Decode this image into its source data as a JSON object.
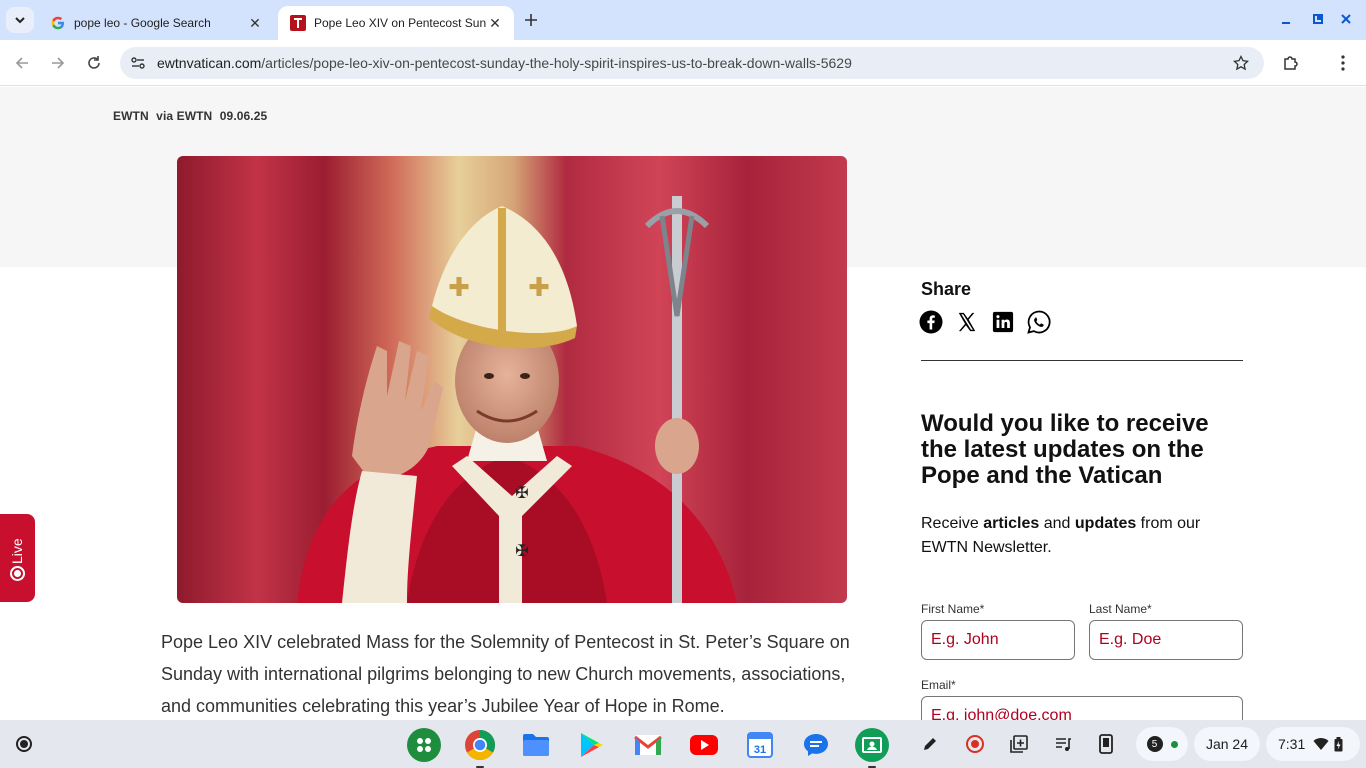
{
  "browser": {
    "tabs": [
      {
        "title": "pope leo - Google Search",
        "active": false,
        "favicon": "google-favicon"
      },
      {
        "title": "Pope Leo XIV on Pentecost Sunday",
        "active": true,
        "favicon": "ewtn-favicon"
      }
    ],
    "url_domain": "ewtnvatican.com",
    "url_path": "/articles/pope-leo-xiv-on-pentecost-sunday-the-holy-spirit-inspires-us-to-break-down-walls-5629"
  },
  "article": {
    "byline": {
      "source": "EWTN",
      "via": "via EWTN",
      "date": "09.06.25"
    },
    "hero_alt": "Pope Leo XIV waving, wearing red vestments and mitre, holding a crucifix staff",
    "paragraph": "Pope Leo XIV celebrated Mass for the Solemnity of Pentecost in St. Peter’s Square on Sunday with international pilgrims belonging to new Church movements, associations, and communities celebrating this year’s Jubilee Year of Hope in Rome."
  },
  "live_tab": {
    "label": "Live"
  },
  "share": {
    "title": "Share",
    "icons": [
      "facebook-icon",
      "x-icon",
      "linkedin-icon",
      "whatsapp-icon"
    ]
  },
  "newsletter": {
    "title": "Would you like to receive the latest updates on the Pope and the Vatican",
    "sub_prefix": "Receive ",
    "sub_bold1": "articles",
    "sub_mid": " and ",
    "sub_bold2": "updates",
    "sub_suffix": " from our EWTN Newsletter.",
    "first_name_label": "First Name*",
    "first_name_placeholder": "E.g. John",
    "last_name_label": "Last Name*",
    "last_name_placeholder": "E.g. Doe",
    "email_label": "Email*",
    "email_placeholder": "E.g. john@doe.com"
  },
  "shelf": {
    "notification_count": "5",
    "date": "Jan 24",
    "time": "7:31"
  },
  "colors": {
    "accent_red": "#c8102e",
    "tabstrip": "#d3e3fd",
    "placeholder_red": "#b00020"
  }
}
